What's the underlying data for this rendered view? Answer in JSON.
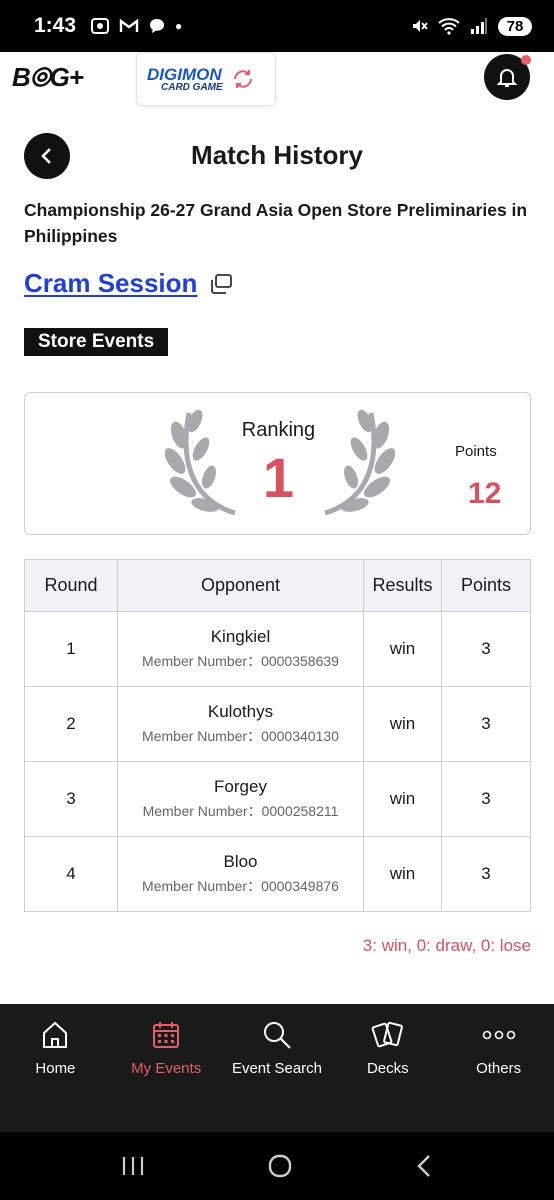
{
  "status_bar": {
    "time": "1:43",
    "battery": "78"
  },
  "header": {
    "logo_text": "B⦾G+",
    "game_logo_top": "DIGIMON",
    "game_logo_bottom": "CARD GAME"
  },
  "page": {
    "title": "Match History",
    "event_name": "Championship 26-27 Grand Asia Open Store Preliminaries in Philippines",
    "store_name": "Cram Session",
    "tag": "Store Events"
  },
  "ranking": {
    "label": "Ranking",
    "value": "1",
    "points_label": "Points",
    "points_value": "12"
  },
  "table": {
    "headers": [
      "Round",
      "Opponent",
      "Results",
      "Points"
    ],
    "rows": [
      {
        "round": "1",
        "opponent": "Kingkiel",
        "member": "Member Number：0000358639",
        "result": "win",
        "points": "3"
      },
      {
        "round": "2",
        "opponent": "Kulothys",
        "member": "Member Number：0000340130",
        "result": "win",
        "points": "3"
      },
      {
        "round": "3",
        "opponent": "Forgey",
        "member": "Member Number：0000258211",
        "result": "win",
        "points": "3"
      },
      {
        "round": "4",
        "opponent": "Bloo",
        "member": "Member Number：0000349876",
        "result": "win",
        "points": "3"
      }
    ]
  },
  "summary": "3: win, 0: draw, 0: lose",
  "nav": [
    {
      "label": "Home",
      "icon": "home-icon"
    },
    {
      "label": "My Events",
      "icon": "calendar-icon"
    },
    {
      "label": "Event Search",
      "icon": "search-icon"
    },
    {
      "label": "Decks",
      "icon": "cards-icon"
    },
    {
      "label": "Others",
      "icon": "more-icon"
    }
  ],
  "colors": {
    "accent": "#d9505f",
    "link": "#1f3fd8",
    "nav_bg": "#1a1a1a"
  }
}
